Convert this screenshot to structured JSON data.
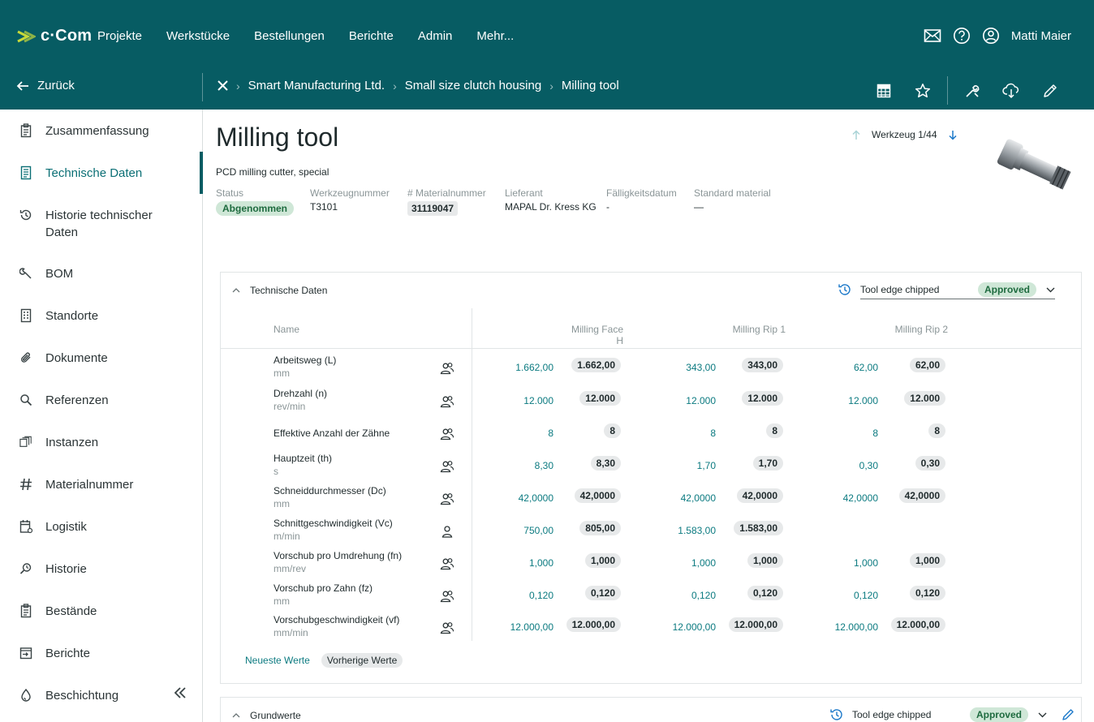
{
  "app": {
    "brand": "c·Com"
  },
  "nav": [
    "Projekte",
    "Werkstücke",
    "Bestellungen",
    "Berichte",
    "Admin",
    "Mehr..."
  ],
  "user": {
    "name": "Matti Maier"
  },
  "subbar": {
    "back_label": "Zurück",
    "breadcrumbs": [
      "Smart Manufacturing Ltd.",
      "Small size clutch housing",
      "Milling tool"
    ]
  },
  "sidebar": {
    "items": [
      {
        "label": "Zusammenfassung",
        "icon": "clipboard-icon"
      },
      {
        "label": "Technische Daten",
        "icon": "document-icon",
        "active": true
      },
      {
        "label": "Historie technischer Daten",
        "icon": "history-icon"
      },
      {
        "label": "BOM",
        "icon": "wrench-icon"
      },
      {
        "label": "Standorte",
        "icon": "building-icon"
      },
      {
        "label": "Dokumente",
        "icon": "paperclip-icon"
      },
      {
        "label": "Referenzen",
        "icon": "search-icon"
      },
      {
        "label": "Instanzen",
        "icon": "instances-icon"
      },
      {
        "label": "Materialnummer",
        "icon": "hash-icon"
      },
      {
        "label": "Logistik",
        "icon": "calendar-icon"
      },
      {
        "label": "Historie",
        "icon": "history-search-icon"
      },
      {
        "label": "Bestände",
        "icon": "clipboard-icon"
      },
      {
        "label": "Berichte",
        "icon": "report-icon"
      },
      {
        "label": "Beschichtung",
        "icon": "drop-icon"
      }
    ]
  },
  "header": {
    "title": "Milling tool",
    "subtitle": "PCD milling cutter, special",
    "counter": "Werkzeug 1/44"
  },
  "meta": {
    "status_label": "Status",
    "status": "Abgenommen",
    "tool_no_label": "Werkzeugnummer",
    "tool_no": "T3101",
    "material_no_label": "# Materialnummer",
    "material_no": "31119047",
    "supplier_label": "Lieferant",
    "supplier": "MAPAL Dr. Kress KG",
    "due_label": "Fälligkeitsdatum",
    "due": "-",
    "std_material_label": "Standard material",
    "std_material": "—"
  },
  "card": {
    "title": "Technische Daten",
    "version": "Tool edge chipped",
    "version_status": "Approved",
    "columns": {
      "name": "Name",
      "c1": "Milling Face H",
      "c2": "Milling Rip 1",
      "c3": "Milling Rip 2"
    },
    "rows": [
      {
        "name": "Arbeitsweg (L)",
        "unit": "mm",
        "icon": "users-icon",
        "v": [
          "1.662,00",
          "1.662,00",
          "343,00",
          "343,00",
          "62,00",
          "62,00"
        ]
      },
      {
        "name": "Drehzahl (n)",
        "unit": "rev/min",
        "icon": "users-icon",
        "v": [
          "12.000",
          "12.000",
          "12.000",
          "12.000",
          "12.000",
          "12.000"
        ]
      },
      {
        "name": "Effektive Anzahl der Zähne",
        "unit": "",
        "icon": "users-icon",
        "v": [
          "8",
          "8",
          "8",
          "8",
          "8",
          "8"
        ]
      },
      {
        "name": "Hauptzeit (th)",
        "unit": "s",
        "icon": "users-icon",
        "v": [
          "8,30",
          "8,30",
          "1,70",
          "1,70",
          "0,30",
          "0,30"
        ]
      },
      {
        "name": "Schneiddurchmesser (Dc)",
        "unit": "mm",
        "icon": "users-icon",
        "v": [
          "42,0000",
          "42,0000",
          "42,0000",
          "42,0000",
          "42,0000",
          "42,0000"
        ]
      },
      {
        "name": "Schnittgeschwindigkeit (Vc)",
        "unit": "m/min",
        "icon": "user-icon",
        "v": [
          "750,00",
          "805,00",
          "1.583,00",
          "1.583,00",
          "",
          ""
        ]
      },
      {
        "name": "Vorschub pro Umdrehung (fn)",
        "unit": "mm/rev",
        "icon": "users-icon",
        "v": [
          "1,000",
          "1,000",
          "1,000",
          "1,000",
          "1,000",
          "1,000"
        ]
      },
      {
        "name": "Vorschub pro Zahn (fz)",
        "unit": "mm",
        "icon": "users-icon",
        "v": [
          "0,120",
          "0,120",
          "0,120",
          "0,120",
          "0,120",
          "0,120"
        ]
      },
      {
        "name": "Vorschubgeschwindigkeit (vf)",
        "unit": "mm/min",
        "icon": "users-icon",
        "v": [
          "12.000,00",
          "12.000,00",
          "12.000,00",
          "12.000,00",
          "12.000,00",
          "12.000,00"
        ]
      }
    ],
    "footer_latest": "Neueste Werte",
    "footer_prev": "Vorherige Werte"
  },
  "card2": {
    "title": "Grundwerte",
    "version": "Tool edge chipped",
    "version_status": "Approved"
  },
  "colors": {
    "topbar": "#075c63",
    "accent": "#0b7a80",
    "approved_bg": "#cfe7d7"
  }
}
